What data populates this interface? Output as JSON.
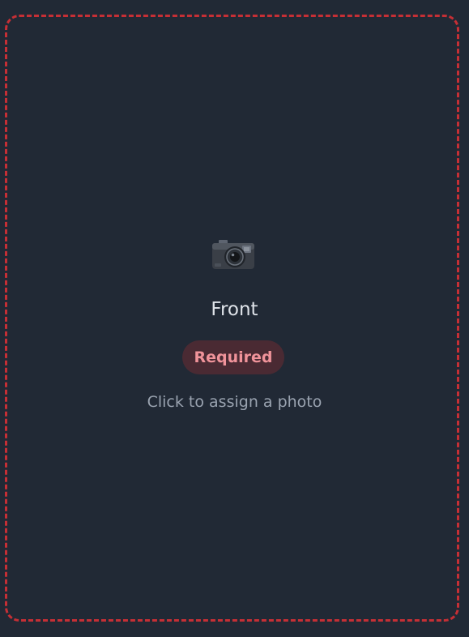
{
  "slot": {
    "title": "Front",
    "badge": "Required",
    "hint": "Click to assign a photo",
    "icon": "camera-icon"
  },
  "colors": {
    "background": "#212935",
    "dashed_border": "#c62f35",
    "badge_background": "#4a2a33",
    "badge_text": "#f0939a"
  }
}
